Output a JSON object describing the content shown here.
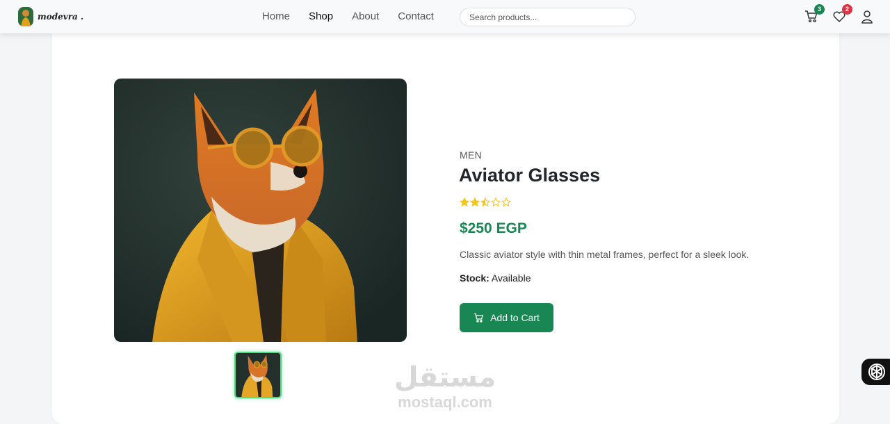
{
  "brand": {
    "name": "modevra ."
  },
  "nav": {
    "links": [
      {
        "label": "Home"
      },
      {
        "label": "Shop"
      },
      {
        "label": "About"
      },
      {
        "label": "Contact"
      }
    ],
    "active_link": "Shop",
    "search": {
      "placeholder": "Search products...",
      "value": ""
    },
    "cart_count": "3",
    "wishlist_count": "2"
  },
  "product": {
    "category": "MEN",
    "name": "Aviator Glasses",
    "rating": 2.5,
    "rating_max": 5,
    "price": "$250 EGP",
    "description": "Classic aviator style with thin metal frames, perfect for a sleek look.",
    "stock_label": "Stock:",
    "stock_value": "Available",
    "add_to_cart_label": "Add to Cart"
  },
  "watermark": {
    "arabic": "مستقل",
    "latin": "mostaql.com"
  },
  "colors": {
    "accent_green": "#198754",
    "star_gold": "#f5c518",
    "cart_badge": "#198754",
    "wishlist_badge": "#dc3545",
    "thumb_border": "#4ade80"
  }
}
